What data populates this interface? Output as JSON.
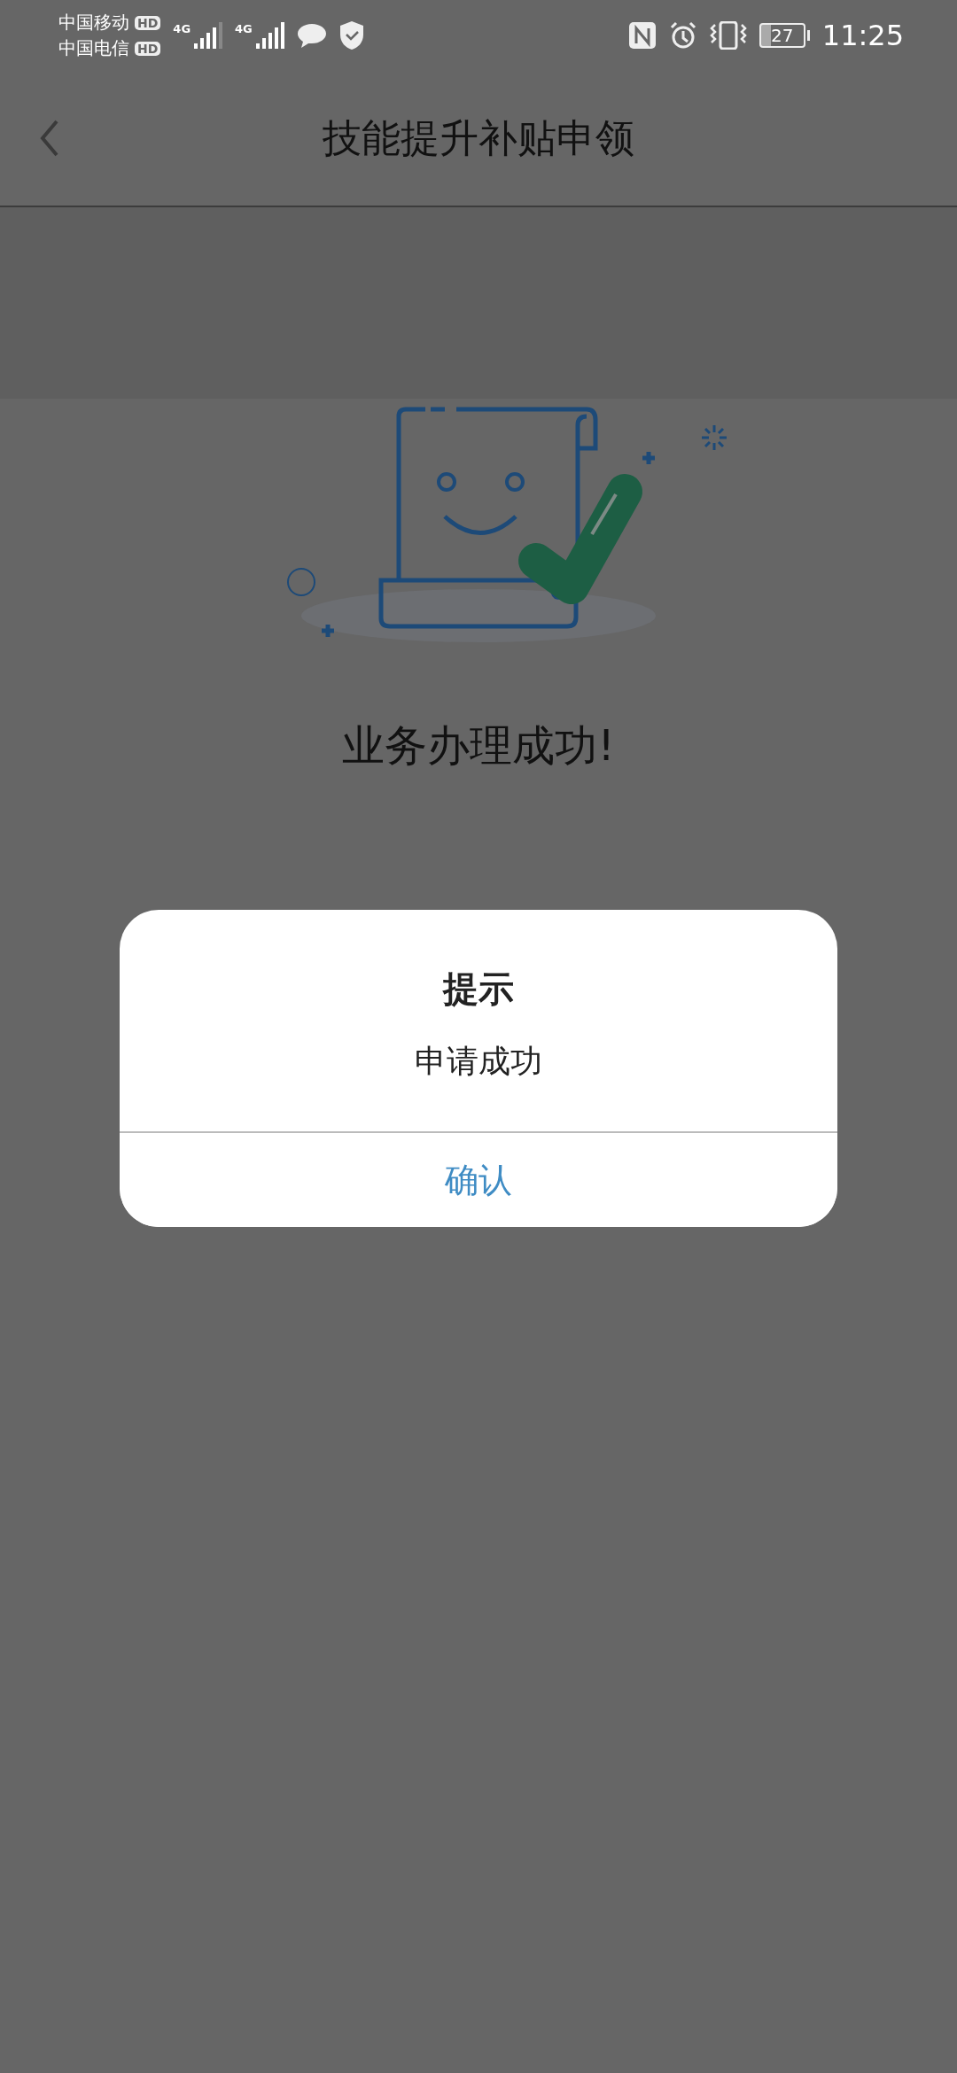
{
  "status_bar": {
    "carriers": [
      {
        "name": "中国移动",
        "badge": "HD"
      },
      {
        "name": "中国电信",
        "badge": "HD"
      }
    ],
    "networks": [
      "4G",
      "4G"
    ],
    "battery": "27",
    "time": "11:25"
  },
  "header": {
    "title": "技能提升补贴申领"
  },
  "result": {
    "message": "业务办理成功!"
  },
  "dialog": {
    "title": "提示",
    "message": "申请成功",
    "confirm": "确认"
  }
}
